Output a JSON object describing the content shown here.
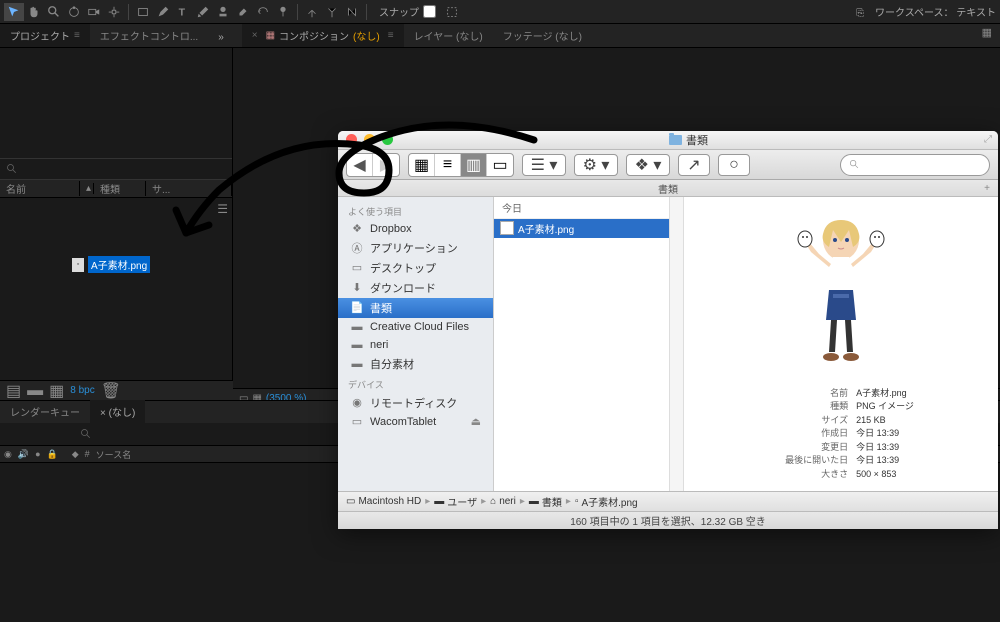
{
  "ae": {
    "snap": "スナップ",
    "workspace": "ワークスペース：  テキスト",
    "tabs": {
      "project": "プロジェクト",
      "effect": "エフェクトコントロ...",
      "composition": "コンポジション",
      "comp_name": "(なし)",
      "layer": "レイヤー (なし)",
      "footage": "フッテージ (なし)"
    },
    "cols": {
      "name": "名前",
      "type": "種類",
      "size": "サ..."
    },
    "file": "A子素材.png",
    "bpc": "8 bpc",
    "zoom": "(3500 %)",
    "timeline": {
      "render": "レンダーキュー",
      "none": "× (なし)",
      "source": "ソース名"
    }
  },
  "finder": {
    "title": "書類",
    "column_title": "書類",
    "date_section": "今日",
    "file": "A子素材.png",
    "sidebar": {
      "favorites": "よく使う項目",
      "items": [
        "Dropbox",
        "アプリケーション",
        "デスクトップ",
        "ダウンロード",
        "書類",
        "Creative Cloud Files",
        "neri",
        "自分素材"
      ],
      "devices": "デバイス",
      "dev_items": [
        "リモートディスク",
        "WacomTablet"
      ]
    },
    "meta": {
      "name_k": "名前",
      "name_v": "A子素材.png",
      "type_k": "種類",
      "type_v": "PNG イメージ",
      "size_k": "サイズ",
      "size_v": "215 KB",
      "created_k": "作成日",
      "created_v": "今日 13:39",
      "modified_k": "変更日",
      "modified_v": "今日 13:39",
      "opened_k": "最後に開いた日",
      "opened_v": "今日 13:39",
      "dim_k": "大きさ",
      "dim_v": "500 × 853"
    },
    "path": [
      "Macintosh HD",
      "ユーザ",
      "neri",
      "書類",
      "A子素材.png"
    ],
    "status": "160 項目中の 1 項目を選択、12.32 GB 空き"
  }
}
